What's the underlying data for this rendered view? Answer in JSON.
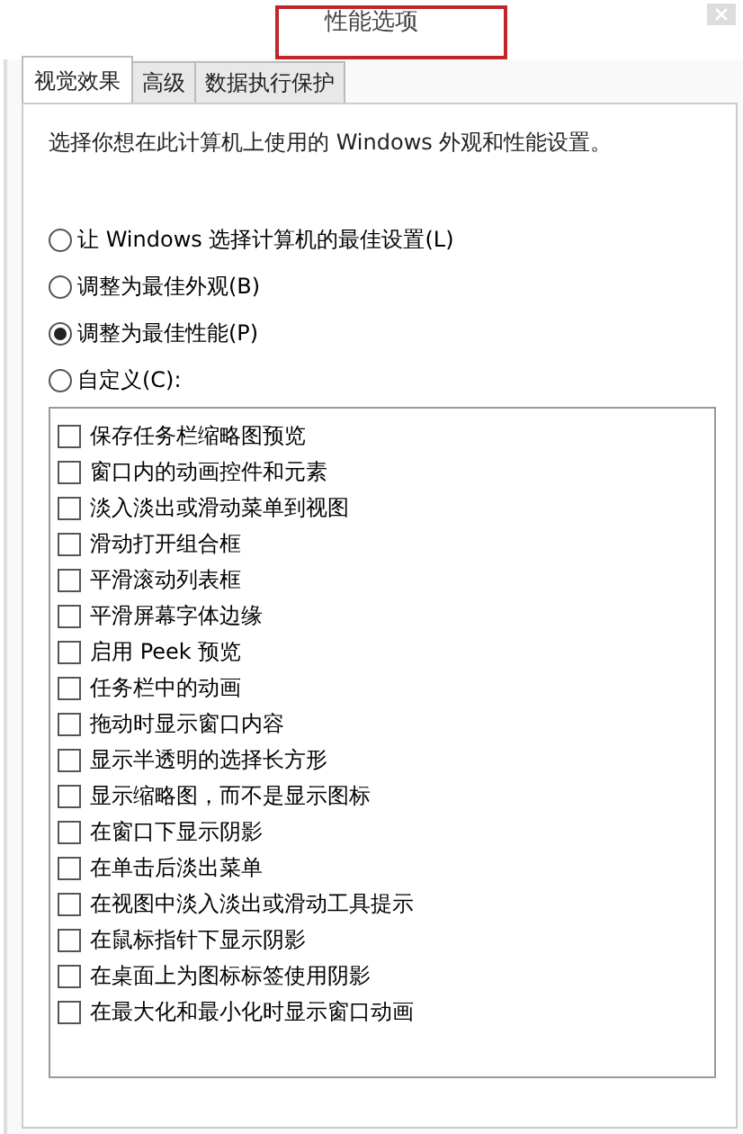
{
  "window": {
    "title": "性能选项"
  },
  "tabs": [
    {
      "label": "视觉效果",
      "selected": true
    },
    {
      "label": "高级",
      "selected": false
    },
    {
      "label": "数据执行保护",
      "selected": false
    }
  ],
  "description": "选择你想在此计算机上使用的 Windows 外观和性能设置。",
  "options": [
    {
      "label": "让 Windows 选择计算机的最佳设置(L)",
      "selected": false
    },
    {
      "label": "调整为最佳外观(B)",
      "selected": false
    },
    {
      "label": "调整为最佳性能(P)",
      "selected": true
    },
    {
      "label": "自定义(C):",
      "selected": false
    }
  ],
  "effects": [
    {
      "label": "保存任务栏缩略图预览",
      "checked": false
    },
    {
      "label": "窗口内的动画控件和元素",
      "checked": false
    },
    {
      "label": "淡入淡出或滑动菜单到视图",
      "checked": false
    },
    {
      "label": "滑动打开组合框",
      "checked": false
    },
    {
      "label": "平滑滚动列表框",
      "checked": false
    },
    {
      "label": "平滑屏幕字体边缘",
      "checked": false
    },
    {
      "label": "启用 Peek 预览",
      "checked": false
    },
    {
      "label": "任务栏中的动画",
      "checked": false
    },
    {
      "label": "拖动时显示窗口内容",
      "checked": false
    },
    {
      "label": "显示半透明的选择长方形",
      "checked": false
    },
    {
      "label": "显示缩略图，而不是显示图标",
      "checked": false
    },
    {
      "label": "在窗口下显示阴影",
      "checked": false
    },
    {
      "label": "在单击后淡出菜单",
      "checked": false
    },
    {
      "label": "在视图中淡入淡出或滑动工具提示",
      "checked": false
    },
    {
      "label": "在鼠标指针下显示阴影",
      "checked": false
    },
    {
      "label": "在桌面上为图标标签使用阴影",
      "checked": false
    },
    {
      "label": "在最大化和最小化时显示窗口动画",
      "checked": false
    }
  ]
}
